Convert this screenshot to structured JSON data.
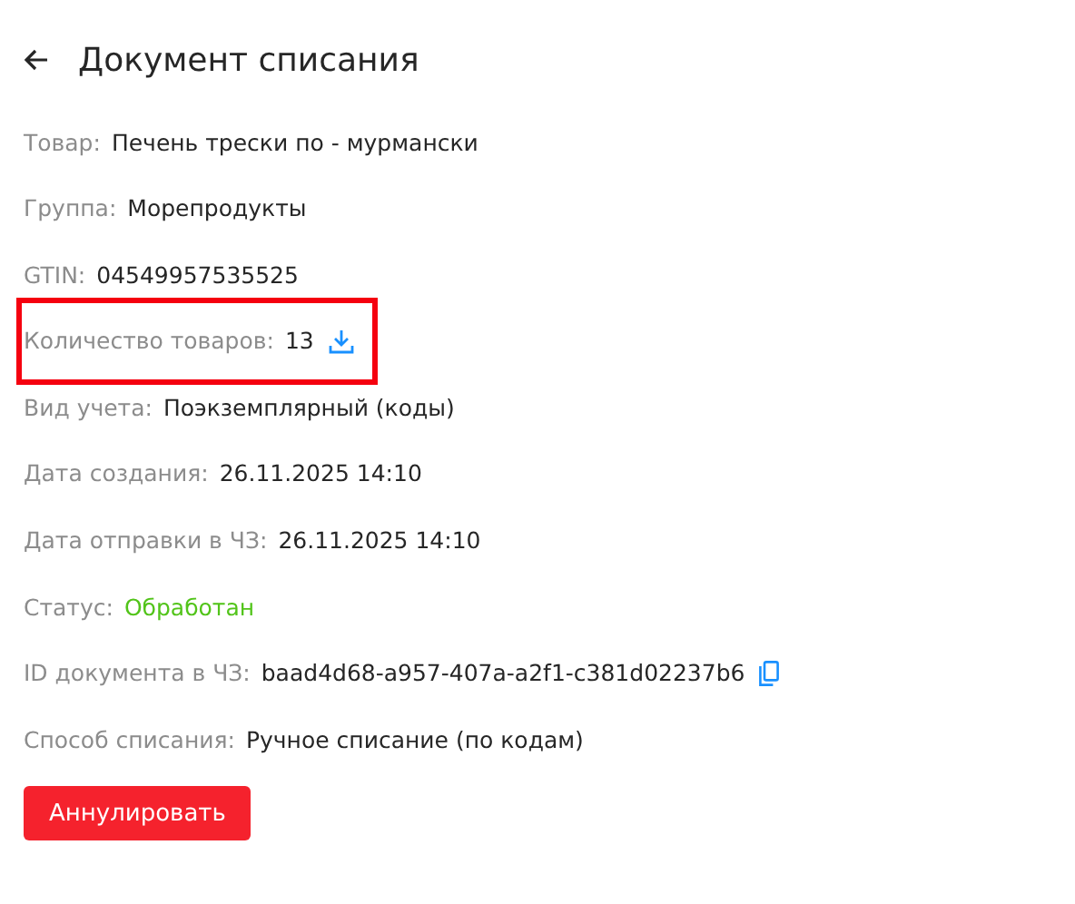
{
  "header": {
    "title": "Документ списания"
  },
  "fields": [
    {
      "label": "Товар:",
      "value": "Печень трески по - мурмански",
      "kind": "text",
      "highlighted": false
    },
    {
      "label": "Группа:",
      "value": "Морепродукты",
      "kind": "text",
      "highlighted": false
    },
    {
      "label": "GTIN:",
      "value": "04549957535525",
      "kind": "text",
      "highlighted": false
    },
    {
      "label": "Количество товаров:",
      "value": "13",
      "kind": "download",
      "highlighted": true
    },
    {
      "label": "Вид учета:",
      "value": "Поэкземплярный (коды)",
      "kind": "text",
      "highlighted": false
    },
    {
      "label": "Дата создания:",
      "value": "26.11.2025 14:10",
      "kind": "text",
      "highlighted": false
    },
    {
      "label": "Дата отправки в ЧЗ:",
      "value": "26.11.2025 14:10",
      "kind": "text",
      "highlighted": false
    },
    {
      "label": "Статус:",
      "value": "Обработан",
      "kind": "status",
      "highlighted": false
    },
    {
      "label": "ID документа в ЧЗ:",
      "value": "baad4d68-a957-407a-a2f1-c381d02237b6",
      "kind": "copy",
      "highlighted": false
    },
    {
      "label": "Способ списания:",
      "value": "Ручное списание (по кодам)",
      "kind": "text",
      "highlighted": false
    }
  ],
  "button": {
    "label": "Аннулировать"
  }
}
